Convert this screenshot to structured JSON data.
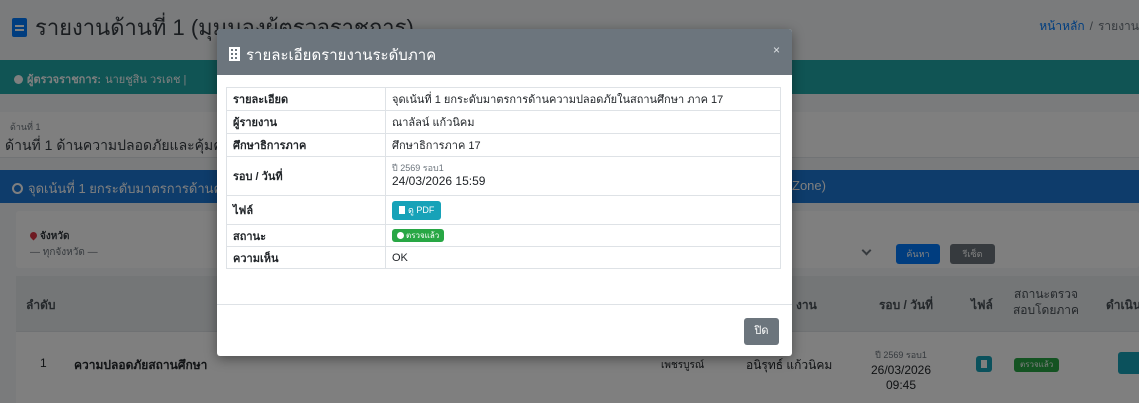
{
  "page": {
    "title": "รายงานด้านที่ 1 (มุมมองผู้ตรวจราชการ)",
    "breadcrumb": {
      "home": "หน้าหลัก",
      "separator": "/",
      "current": "รายงาน"
    }
  },
  "auditor": {
    "label": "ผู้ตรวจราชการ:",
    "name": "นายชูสิน วรเดช",
    "divider": "|"
  },
  "aspect": {
    "small_label": "ด้านที่ 1",
    "title": "ด้านที่ 1 ด้านความปลอดภัยและคุ้มครองนักเรียน"
  },
  "focus": {
    "text": "จุดเน้นที่ 1 ยกระดับมาตรการด้านความปลอดภัยในสถานศึกษา",
    "zone": "Zone)"
  },
  "filter": {
    "province_label": "จังหวัด",
    "province_value": "— ทุกจังหวัด —",
    "search_label": "ค้นหา",
    "reset_label": "รีเซ็ต"
  },
  "table": {
    "headers": {
      "no": "ลำดับ",
      "reporter": "งาน",
      "round": "รอบ / วันที่",
      "file": "ไฟล์",
      "status": "สถานะตรวจสอบโดยภาค",
      "action": "ดำเนิน"
    },
    "rows": [
      {
        "no": "1",
        "topic": "ความปลอดภัยสถานศึกษา",
        "province": "เพชรบูรณ์",
        "reporter": "อนิรุทธ์ แก้วนิคม",
        "round_sub": "ปี 2569 รอบ1",
        "date": "26/03/2026",
        "time": "09:45",
        "status": "ตรวจแล้ว"
      }
    ]
  },
  "modal": {
    "title": "รายละเอียดรายงานระดับภาค",
    "close_icon": "×",
    "rows": {
      "detail_label": "รายละเอียด",
      "detail_value": "จุดเน้นที่ 1 ยกระดับมาตรการด้านความปลอดภัยในสถานศึกษา ภาค 17",
      "reporter_label": "ผู้รายงาน",
      "reporter_value": "ณาลัลน์ แก้วนิคม",
      "region_label": "ศึกษาธิการภาค",
      "region_value": "ศึกษาธิการภาค 17",
      "round_label": "รอบ / วันที่",
      "round_sub": "ปี 2569 รอบ1",
      "round_date": "24/03/2026 15:59",
      "file_label": "ไฟล์",
      "file_button": "ดู PDF",
      "status_label": "สถานะ",
      "status_value": "ตรวจแล้ว",
      "comment_label": "ความเห็น",
      "comment_value": "OK"
    },
    "footer_close": "ปิด"
  },
  "colors": {
    "primary": "#007bff",
    "info": "#17a2b8",
    "success": "#28a745",
    "secondary": "#6c757d",
    "teal_bar": "#20a8a8",
    "focus_bar": "#1c79d6"
  }
}
